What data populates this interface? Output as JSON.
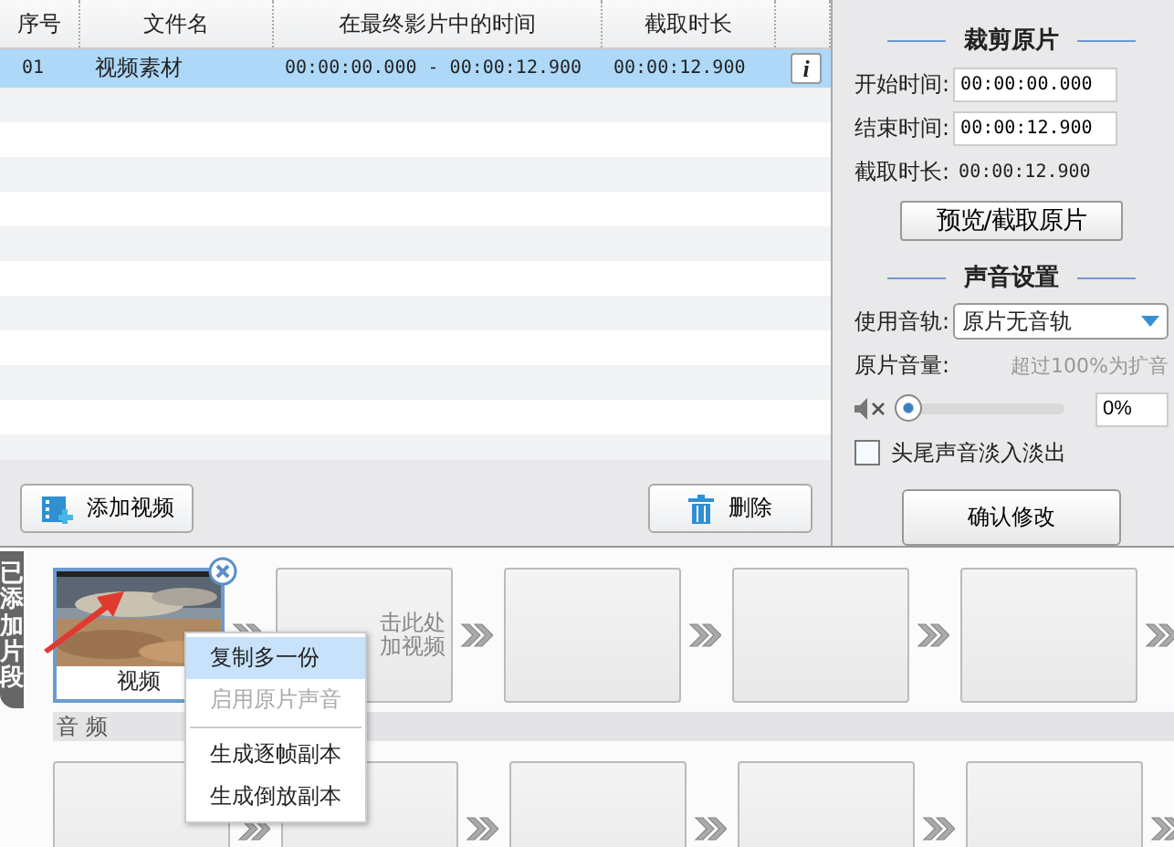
{
  "table": {
    "columns": [
      "序号",
      "文件名",
      "在最终影片中的时间",
      "截取时长"
    ],
    "rows": [
      {
        "index": "01",
        "name": "视频素材",
        "time_range": "00:00:00.000 - 00:00:12.900",
        "duration": "00:00:12.900",
        "info": "i",
        "selected": true
      }
    ]
  },
  "list_buttons": [
    {
      "kind": "add",
      "label": "添加视频"
    },
    {
      "kind": "delete",
      "label": "删除"
    }
  ],
  "trim": {
    "title": "裁剪原片",
    "fields": [
      {
        "kind": "input",
        "label": "开始时间:",
        "value": "00:00:00.000"
      },
      {
        "kind": "input",
        "label": "结束时间:",
        "value": "00:00:12.900"
      },
      {
        "kind": "text",
        "label": "截取时长:",
        "value": "00:00:12.900"
      }
    ],
    "button": "预览/截取原片"
  },
  "audio": {
    "title": "声音设置",
    "track_label": "使用音轨:",
    "track_value": "原片无音轨",
    "volume_label": "原片音量:",
    "volume_hint": "超过100%为扩音",
    "muted": true,
    "volume": {
      "level": 0
    },
    "volume_value": "0%",
    "fade": {
      "label": "头尾声音淡入淡出",
      "checked": false
    },
    "confirm": "确认修改"
  },
  "timeline": {
    "tab_label": "已添加片段",
    "audio_label": "音 频",
    "clips": [
      {
        "kind": "video",
        "label": "视频",
        "selected": true
      },
      {
        "kind": "placeholder",
        "lines": [
          "击此处",
          "加视频"
        ]
      },
      {
        "kind": "empty"
      },
      {
        "kind": "empty"
      },
      {
        "kind": "empty"
      }
    ],
    "audio_slots": [
      {
        "kind": "empty"
      },
      {
        "kind": "empty"
      },
      {
        "kind": "empty"
      },
      {
        "kind": "empty"
      },
      {
        "kind": "empty"
      }
    ]
  },
  "context_menu": {
    "items": [
      {
        "kind": "item",
        "label": "复制多一份",
        "selected": true,
        "disabled": false
      },
      {
        "kind": "item",
        "label": "启用原片声音",
        "selected": false,
        "disabled": true
      },
      {
        "kind": "separator"
      },
      {
        "kind": "item",
        "label": "生成逐帧副本",
        "selected": false,
        "disabled": false
      },
      {
        "kind": "item",
        "label": "生成倒放副本",
        "selected": false,
        "disabled": false
      }
    ]
  }
}
